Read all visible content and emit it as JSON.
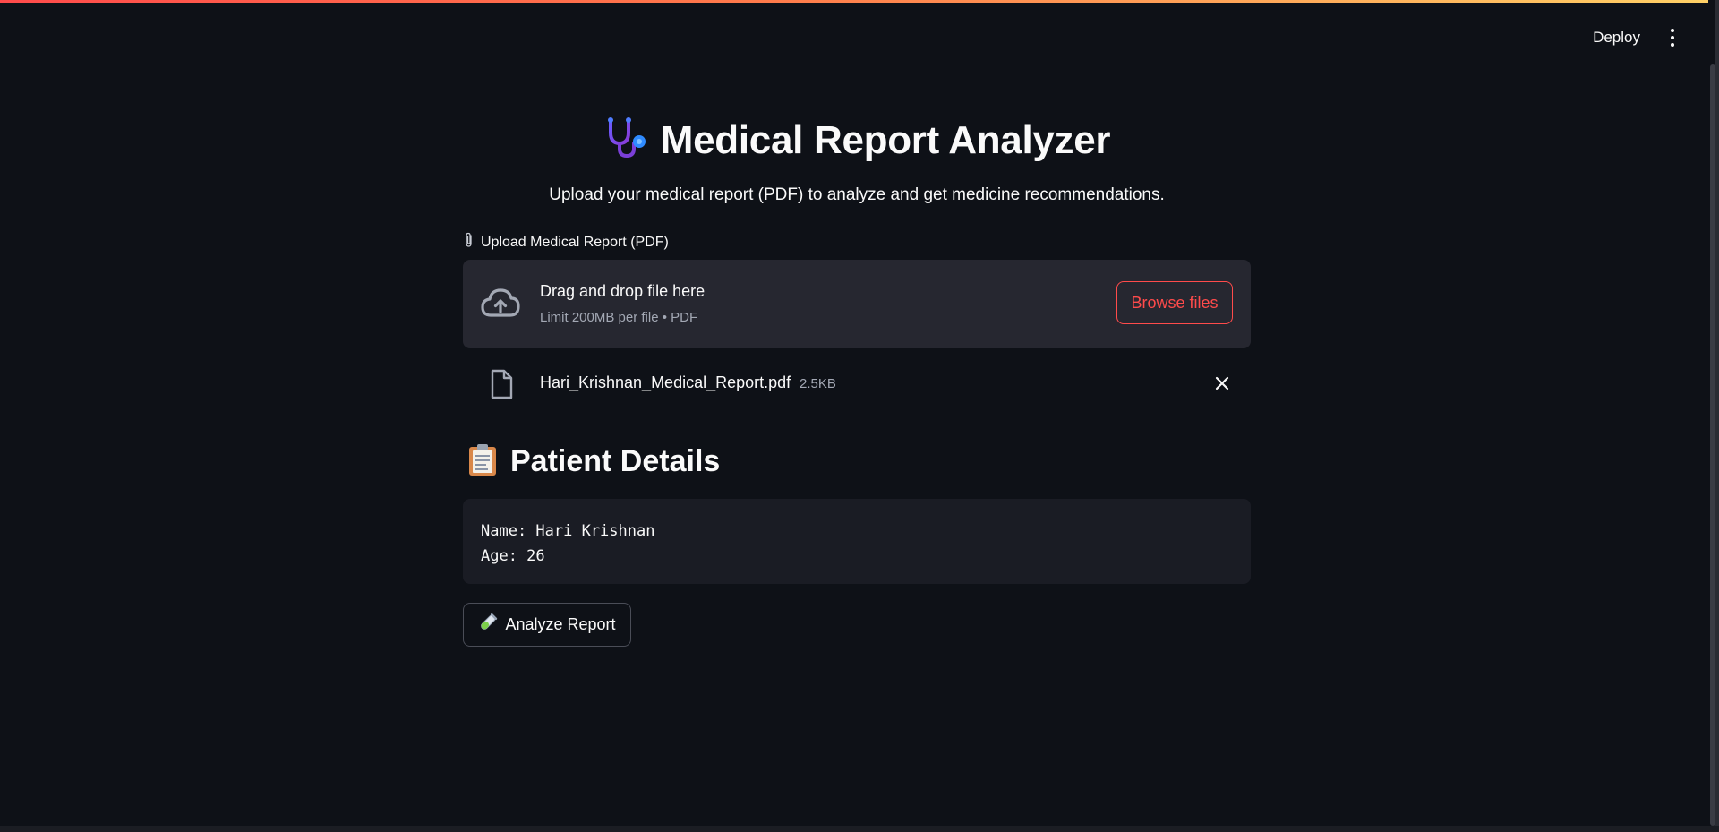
{
  "header": {
    "deploy_label": "Deploy",
    "menu_icon": "vertical-ellipsis-icon"
  },
  "app": {
    "title": "Medical Report Analyzer",
    "title_icon": "stethoscope-icon",
    "subtitle": "Upload your medical report (PDF) to analyze and get medicine recommendations."
  },
  "uploader": {
    "label": "Upload Medical Report (PDF)",
    "label_icon": "paperclip-icon",
    "drop_title": "Drag and drop file here",
    "drop_limit": "Limit 200MB per file • PDF",
    "browse_label": "Browse files",
    "uploaded_file": {
      "name": "Hari_Krishnan_Medical_Report.pdf",
      "size": "2.5KB"
    }
  },
  "patient": {
    "section_title": "Patient Details",
    "section_icon": "clipboard-icon",
    "lines": [
      "Name: Hari Krishnan",
      "Age: 26"
    ]
  },
  "actions": {
    "analyze_label": "Analyze Report",
    "analyze_icon": "test-tube-icon"
  },
  "colors": {
    "background": "#0e1117",
    "accent": "#ff4b4b",
    "surface": "#262730",
    "code_background": "#1a1c24"
  }
}
